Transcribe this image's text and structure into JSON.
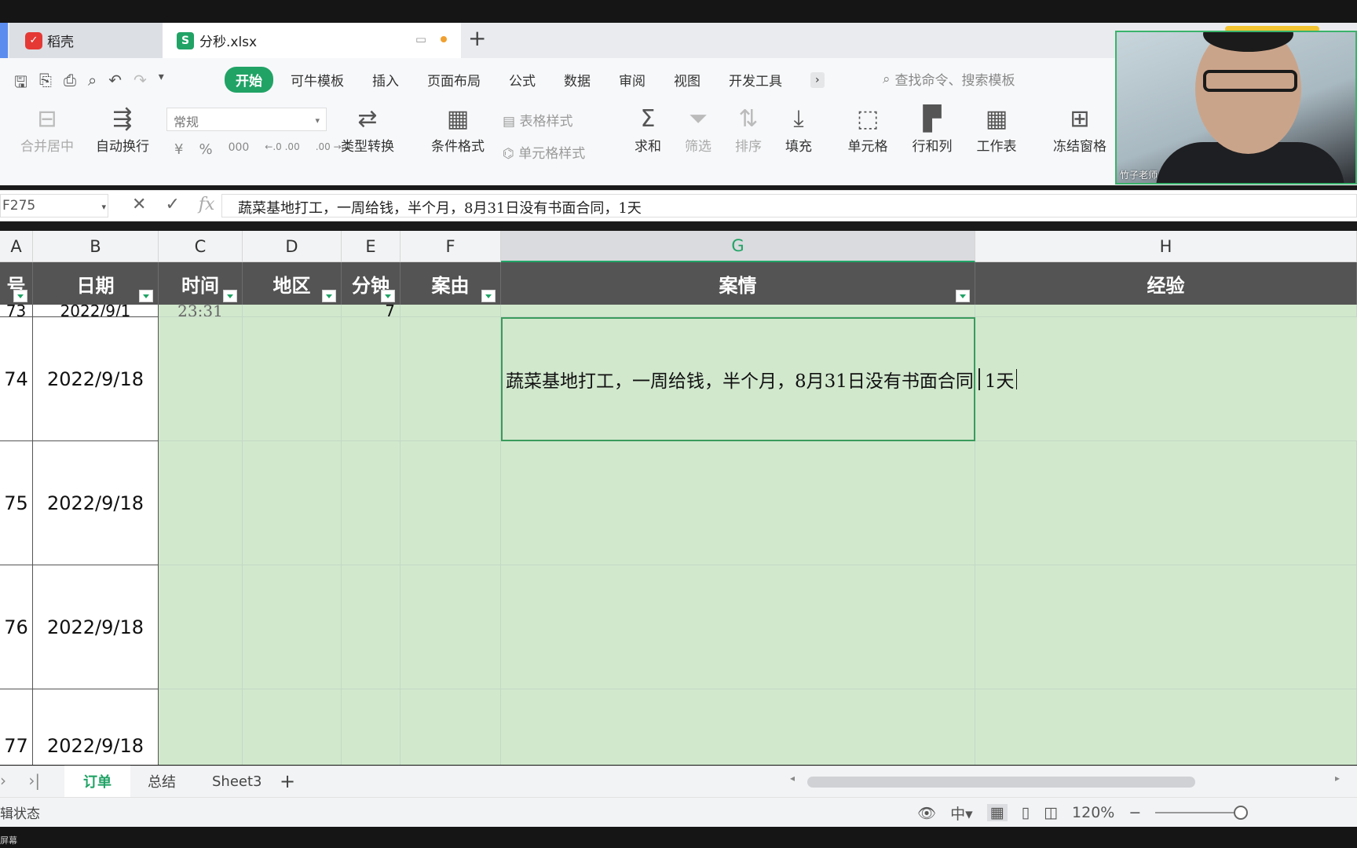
{
  "tabs": {
    "app_name": "稻壳",
    "file_name": "分秒.xlsx"
  },
  "menu": {
    "start": "开始",
    "items": [
      "可牛模板",
      "插入",
      "页面布局",
      "公式",
      "数据",
      "审阅",
      "视图",
      "开发工具"
    ],
    "more": "›",
    "search_placeholder": "查找命令、搜索模板"
  },
  "ribbon": {
    "merge": "合并居中",
    "wrap": "自动换行",
    "number_format": "常规",
    "convert": "类型转换",
    "cond_format": "条件格式",
    "table_style": "表格样式",
    "cell_style": "单元格样式",
    "sum": "求和",
    "filter": "筛选",
    "sort": "排序",
    "fill": "填充",
    "cell": "单元格",
    "row_col": "行和列",
    "worksheet": "工作表",
    "freeze": "冻结窗格",
    "number_symbols": [
      "¥",
      "%",
      "000",
      "←.0 .00",
      ".00 →.0"
    ]
  },
  "webcam": {
    "name": "竹子老师"
  },
  "formula_bar": {
    "name_box": "F275",
    "content": "蔬菜基地打工，一周给钱，半个月，8月31日没有书面合同，1天"
  },
  "columns": [
    "A",
    "B",
    "C",
    "D",
    "E",
    "F",
    "G",
    "H"
  ],
  "header_row": {
    "a": "号",
    "b": "日期",
    "c": "时间",
    "d": "地区",
    "e": "分钟",
    "f": "案由",
    "g": "案情",
    "h": "经验"
  },
  "partial_row": {
    "a": "73",
    "b": "2022/9/1",
    "c": "23:31",
    "e": "7"
  },
  "rows": [
    {
      "num": "74",
      "date": "2022/9/18",
      "case_text": "蔬菜基地打工，一周给钱，半个月，8月31日没有书面合同",
      "case_tail": "1天"
    },
    {
      "num": "75",
      "date": "2022/9/18"
    },
    {
      "num": "76",
      "date": "2022/9/18"
    },
    {
      "num": "77",
      "date": "2022/9/18"
    }
  ],
  "sheets": {
    "active": "订单",
    "others": [
      "总结",
      "Sheet3"
    ],
    "add": "+"
  },
  "status": {
    "left": "辑状态",
    "zoom": "120%",
    "bottom_label": "屏幕"
  }
}
